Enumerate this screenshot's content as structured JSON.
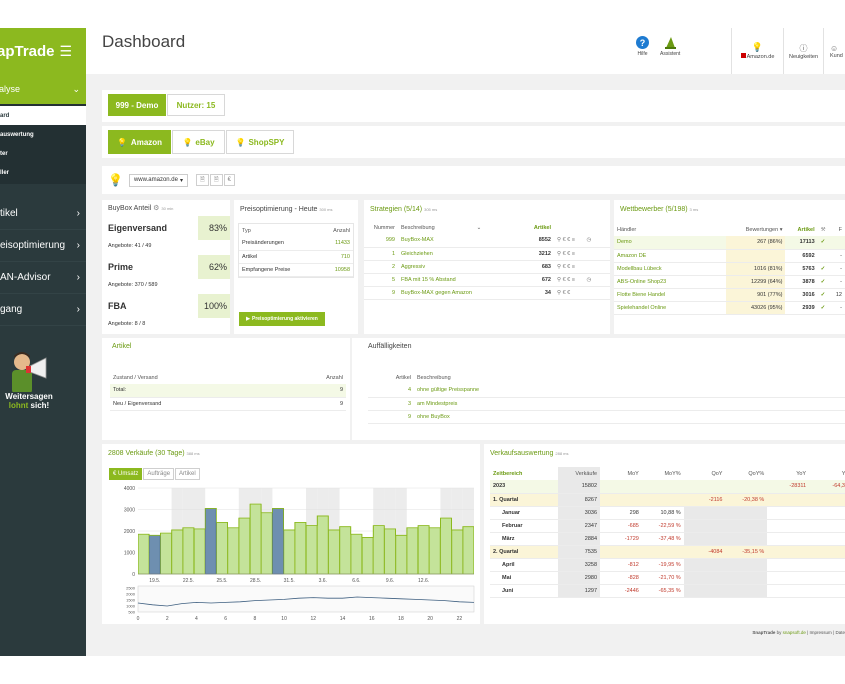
{
  "sidebar": {
    "brand": "apTrade",
    "active_section": "alyse",
    "sub_items": [
      "ard",
      "auswertung",
      "ter",
      "ller"
    ],
    "items": [
      "tikel",
      "eisoptimierung",
      "AN-Advisor",
      "gang"
    ],
    "promo_line1": "Weitersagen",
    "promo_line2a": "lohnt ",
    "promo_line2b": "sich!"
  },
  "header": {
    "title": "Dashboard",
    "hilfe": "Hilfe",
    "assistent": "Assistent",
    "marketplace": "Amazon.de",
    "neuigkeiten": "Neuigkeiten",
    "kunde": "Kund"
  },
  "account": {
    "name": "999 - Demo",
    "users": "Nutzer: 15"
  },
  "channels": {
    "amazon": "Amazon",
    "ebay": "eBay",
    "shopspy": "ShopSPY"
  },
  "marketplace_select": "www.amazon.de",
  "buybox": {
    "title": "BuyBox Anteil",
    "unit": "30 min",
    "rows": [
      {
        "label": "Eigenversand",
        "pct": "83%",
        "pct_value": 0.83,
        "sub": "Angebote: 41 / 49"
      },
      {
        "label": "Prime",
        "pct": "62%",
        "pct_value": 0.62,
        "sub": "Angebote: 370 / 589"
      },
      {
        "label": "FBA",
        "pct": "100%",
        "pct_value": 1.0,
        "sub": "Angebote: 8 / 8"
      }
    ]
  },
  "preis": {
    "title": "Preisoptimierung - Heute",
    "unit": "300 ms",
    "col_typ": "Typ",
    "col_anzahl": "Anzahl",
    "rows": [
      {
        "typ": "Preisänderungen",
        "n": "11433"
      },
      {
        "typ": "Artikel",
        "n": "710"
      },
      {
        "typ": "Empfangene Preise",
        "n": "10958"
      }
    ],
    "button": "Preisoptimierung aktivieren"
  },
  "strategien": {
    "title": "Strategien (5/14)",
    "unit": "305 ms",
    "col_nr": "Nummer",
    "col_desc": "Beschreibung",
    "col_art": "Artikel",
    "rows": [
      {
        "nr": "999",
        "desc": "BuyBox-MAX",
        "art": "8552"
      },
      {
        "nr": "1",
        "desc": "Gleichziehen",
        "art": "3212"
      },
      {
        "nr": "2",
        "desc": "Aggressiv",
        "art": "683"
      },
      {
        "nr": "5",
        "desc": "FBA mit 15 % Abstand",
        "art": "672"
      },
      {
        "nr": "9",
        "desc": "BuyBox-MAX gegen Amazon",
        "art": "34"
      }
    ]
  },
  "wettbewerber": {
    "title": "Wettbewerber (5/198)",
    "unit": "3 ms",
    "col_h": "Händler",
    "col_b": "Bewertungen",
    "col_a": "Artikel",
    "rows": [
      {
        "h": "Demo",
        "b": "267 (86%)",
        "a": "17113",
        "x": ""
      },
      {
        "h": "Amazon DE",
        "b": "",
        "a": "6592",
        "x": "-"
      },
      {
        "h": "Modellbau Lübeck",
        "b": "1016 (81%)",
        "a": "5763",
        "x": "-"
      },
      {
        "h": "ABS-Online Shop23",
        "b": "12299 (64%)",
        "a": "3878",
        "x": "-"
      },
      {
        "h": "Flotte Biene Handel",
        "b": "901 (77%)",
        "a": "3016",
        "x": "12"
      },
      {
        "h": "Spielehandel Online",
        "b": "43026 (95%)",
        "a": "2939",
        "x": "-"
      }
    ]
  },
  "artikel": {
    "title": "Artikel",
    "col_z": "Zustand / Versand",
    "col_a": "Anzahl",
    "rows": [
      {
        "z": "Total:",
        "n": "9"
      },
      {
        "z": "Neu / Eigenversand",
        "n": "9"
      }
    ]
  },
  "auff": {
    "title": "Auffälligkeiten",
    "col_a": "Artikel",
    "col_b": "Beschreibung",
    "rows": [
      {
        "n": "4",
        "d": "ohne gültige Preisspanne"
      },
      {
        "n": "3",
        "d": "am Mindestpreis"
      },
      {
        "n": "9",
        "d": "ohne BuyBox"
      }
    ]
  },
  "sales": {
    "title": "2808 Verkäufe (30 Tage)",
    "unit": "388 ms",
    "tabs": [
      "€ Umsatz",
      "Aufträge",
      "Artikel"
    ],
    "x_labels": [
      "19.5.",
      "22.5.",
      "25.5.",
      "28.5.",
      "31.5.",
      "3.6.",
      "6.6.",
      "9.6.",
      "12.6."
    ],
    "y_labels": [
      "4000",
      "3000",
      "2000",
      "1000",
      "0"
    ],
    "mini_y": [
      "2500",
      "2000",
      "1500",
      "1000",
      "500"
    ],
    "mini_x": [
      "0",
      "2",
      "4",
      "6",
      "8",
      "10",
      "12",
      "14",
      "16",
      "18",
      "20",
      "22"
    ]
  },
  "chart_data": {
    "type": "bar",
    "y_range": [
      0,
      4000
    ],
    "values": [
      1850,
      1800,
      1900,
      2050,
      2150,
      2100,
      3050,
      2400,
      2150,
      2600,
      3250,
      2850,
      3050,
      2050,
      2400,
      2250,
      2700,
      2050,
      2200,
      1850,
      1700,
      2250,
      2100,
      1800,
      2150,
      2250,
      2150,
      2600,
      2050,
      2200
    ],
    "highlight": [
      false,
      true,
      false,
      false,
      false,
      false,
      true,
      false,
      false,
      false,
      false,
      false,
      true,
      false,
      false,
      false,
      false,
      false,
      false,
      false,
      false,
      false,
      false,
      false,
      false,
      false,
      false,
      false,
      false,
      false
    ],
    "mini_x_range": [
      0,
      23
    ],
    "mini_values": [
      1250,
      1100,
      1000,
      1200,
      1300,
      1250,
      1300,
      1350,
      1450,
      1500,
      1550,
      1650,
      1700,
      1650,
      1650,
      1750,
      1700,
      1650,
      1600,
      1550,
      1500,
      1450,
      1350,
      1300
    ]
  },
  "va": {
    "title": "Verkaufsauswertung",
    "unit": "288 ms",
    "cols": [
      "Zeitbereich",
      "Verkäufe",
      "MoY",
      "MoY%",
      "QoY",
      "QoY%",
      "YoY",
      "Yo"
    ],
    "rows": [
      {
        "l": "2023",
        "v": "15802",
        "m": "",
        "mp": "",
        "q": "",
        "qp": "",
        "y": "-28311",
        "yp": "-64,36",
        "t": "y"
      },
      {
        "l": "1. Quartal",
        "v": "8267",
        "m": "",
        "mp": "",
        "q": "-2116",
        "qp": "-20,38 %",
        "y": "",
        "yp": "",
        "t": "q"
      },
      {
        "l": "Januar",
        "v": "3036",
        "m": "298",
        "mp": "10,88 %",
        "q": "",
        "qp": "",
        "y": "",
        "yp": "",
        "t": "m"
      },
      {
        "l": "Februar",
        "v": "2347",
        "m": "-685",
        "mp": "-22,59 %",
        "q": "",
        "qp": "",
        "y": "",
        "yp": "",
        "t": "m"
      },
      {
        "l": "März",
        "v": "2884",
        "m": "-1729",
        "mp": "-37,48 %",
        "q": "",
        "qp": "",
        "y": "",
        "yp": "",
        "t": "m"
      },
      {
        "l": "2. Quartal",
        "v": "7535",
        "m": "",
        "mp": "",
        "q": "-4084",
        "qp": "-35,15 %",
        "y": "",
        "yp": "",
        "t": "q"
      },
      {
        "l": "April",
        "v": "3258",
        "m": "-812",
        "mp": "-19,95 %",
        "q": "",
        "qp": "",
        "y": "",
        "yp": "",
        "t": "m"
      },
      {
        "l": "Mai",
        "v": "2980",
        "m": "-828",
        "mp": "-21,70 %",
        "q": "",
        "qp": "",
        "y": "",
        "yp": "",
        "t": "m"
      },
      {
        "l": "Juni",
        "v": "1297",
        "m": "-2446",
        "mp": "-65,35 %",
        "q": "",
        "qp": "",
        "y": "",
        "yp": "",
        "t": "m"
      }
    ]
  },
  "footer": {
    "brand": "SnapTrade",
    "by": " by ",
    "site": "snapsoft.de",
    "sep": " | ",
    "impressum": "Impressum",
    "sep2": " | ",
    "datenschutz": "Date"
  }
}
